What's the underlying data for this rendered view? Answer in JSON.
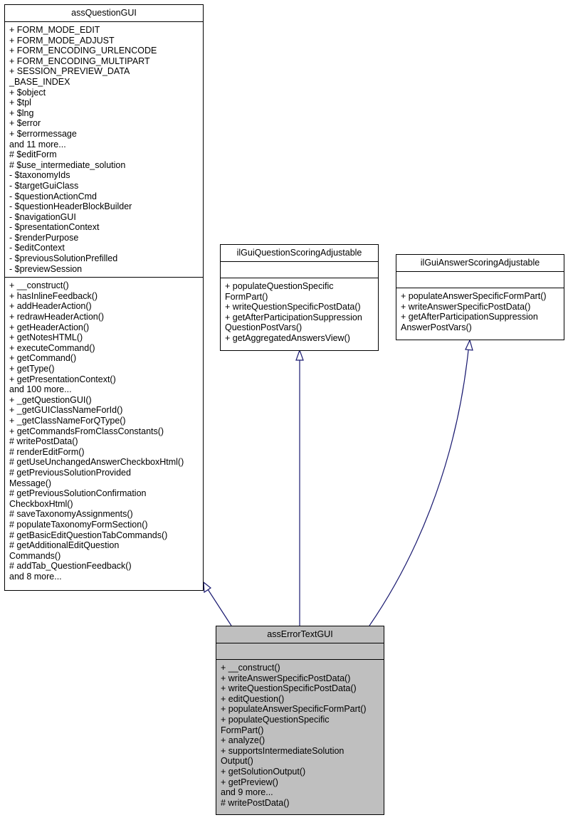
{
  "classes": {
    "assQuestionGUI": {
      "name": "assQuestionGUI",
      "attributes": [
        "+ FORM_MODE_EDIT",
        "+ FORM_MODE_ADJUST",
        "+ FORM_ENCODING_URLENCODE",
        "+ FORM_ENCODING_MULTIPART",
        "+ SESSION_PREVIEW_DATA",
        "_BASE_INDEX",
        "+ $object",
        "+ $tpl",
        "+ $lng",
        "+ $error",
        "+ $errormessage",
        "and 11 more...",
        "# $editForm",
        "# $use_intermediate_solution",
        "- $taxonomyIds",
        "- $targetGuiClass",
        "- $questionActionCmd",
        "- $questionHeaderBlockBuilder",
        "- $navigationGUI",
        "- $presentationContext",
        "- $renderPurpose",
        "- $editContext",
        "- $previousSolutionPrefilled",
        "- $previewSession"
      ],
      "methods": [
        "+ __construct()",
        "+ hasInlineFeedback()",
        "+ addHeaderAction()",
        "+ redrawHeaderAction()",
        "+ getHeaderAction()",
        "+ getNotesHTML()",
        "+ executeCommand()",
        "+ getCommand()",
        "+ getType()",
        "+ getPresentationContext()",
        "and 100 more...",
        "+ _getQuestionGUI()",
        "+ _getGUIClassNameForId()",
        "+ _getClassNameForQType()",
        "+ getCommandsFromClassConstants()",
        "# writePostData()",
        "# renderEditForm()",
        "# getUseUnchangedAnswerCheckboxHtml()",
        "# getPreviousSolutionProvided",
        "Message()",
        "# getPreviousSolutionConfirmation",
        "CheckboxHtml()",
        "# saveTaxonomyAssignments()",
        "# populateTaxonomyFormSection()",
        "# getBasicEditQuestionTabCommands()",
        "# getAdditionalEditQuestion",
        "Commands()",
        "# addTab_QuestionFeedback()",
        "and 8 more..."
      ]
    },
    "ilGuiQuestionScoringAdjustable": {
      "name": "ilGuiQuestionScoringAdjustable",
      "attributes": [],
      "methods": [
        "+ populateQuestionSpecific",
        "FormPart()",
        "+ writeQuestionSpecificPostData()",
        "+ getAfterParticipationSuppression",
        "QuestionPostVars()",
        "+ getAggregatedAnswersView()"
      ]
    },
    "ilGuiAnswerScoringAdjustable": {
      "name": "ilGuiAnswerScoringAdjustable",
      "attributes": [],
      "methods": [
        "+ populateAnswerSpecificFormPart()",
        "+ writeAnswerSpecificPostData()",
        "+ getAfterParticipationSuppression",
        "AnswerPostVars()"
      ]
    },
    "assErrorTextGUI": {
      "name": "assErrorTextGUI",
      "attributes": [],
      "methods": [
        "+ __construct()",
        "+ writeAnswerSpecificPostData()",
        "+ writeQuestionSpecificPostData()",
        "+ editQuestion()",
        "+ populateAnswerSpecificFormPart()",
        "+ populateQuestionSpecific",
        "FormPart()",
        "+ analyze()",
        "+ supportsIntermediateSolution",
        "Output()",
        "+ getSolutionOutput()",
        "+ getPreview()",
        "and 9 more...",
        "# writePostData()"
      ]
    }
  },
  "edges": [
    {
      "from": "assErrorTextGUI",
      "to": "assQuestionGUI",
      "type": "inheritance"
    },
    {
      "from": "assErrorTextGUI",
      "to": "ilGuiQuestionScoringAdjustable",
      "type": "inheritance"
    },
    {
      "from": "assErrorTextGUI",
      "to": "ilGuiAnswerScoringAdjustable",
      "type": "inheritance"
    }
  ],
  "colors": {
    "edge": "#191970",
    "highlight_fill": "#bfbfbf",
    "border": "#000000"
  }
}
